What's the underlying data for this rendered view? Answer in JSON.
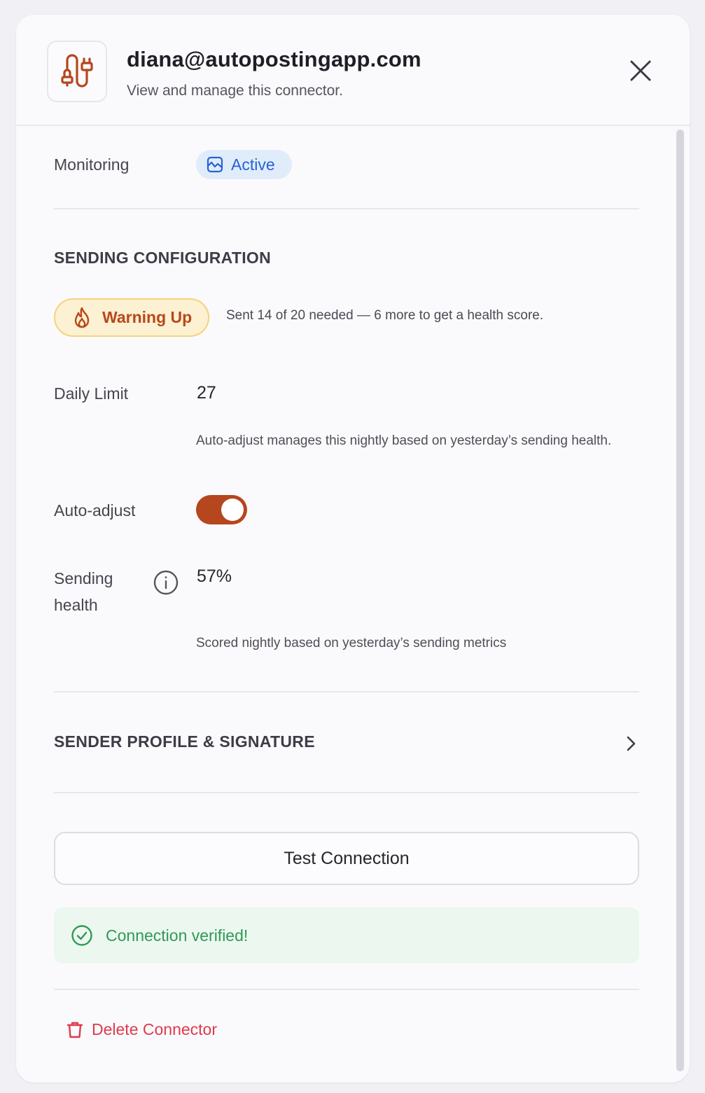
{
  "header": {
    "title": "diana@autopostingapp.com",
    "subtitle": "View and manage this connector.",
    "connector_icon": "plug-connector-icon",
    "close_icon": "close-icon"
  },
  "monitoring": {
    "label": "Monitoring",
    "status": "Active",
    "status_icon": "chart-monitor-icon",
    "status_color": "#2463d6"
  },
  "sending_configuration": {
    "section_title": "SENDING CONFIGURATION",
    "warmup_badge": "Warning Up",
    "warmup_icon": "flame-icon",
    "warmup_text": "Sent 14 of 20 needed — 6 more to get a health score.",
    "daily_limit_label": "Daily Limit",
    "daily_limit_value": "27",
    "daily_limit_helper": "Auto-adjust manages this nightly based on yesterday’s sending health.",
    "auto_adjust_label": "Auto-adjust",
    "auto_adjust_enabled": true,
    "sending_health_label_line1": "Sending",
    "sending_health_label_line2": "health",
    "sending_health_value": "57%",
    "sending_health_helper": "Scored nightly based on yesterday’s sending metrics",
    "accent_color": "#b5461d"
  },
  "sender_profile": {
    "section_title": "SENDER PROFILE & SIGNATURE",
    "chevron_icon": "chevron-right-icon"
  },
  "actions": {
    "test_connection_label": "Test Connection",
    "verified_text": "Connection verified!",
    "verified_icon": "check-circle-icon",
    "verified_color": "#2f9a55",
    "delete_label": "Delete Connector",
    "delete_icon": "trash-icon",
    "delete_color": "#df3a4b"
  }
}
